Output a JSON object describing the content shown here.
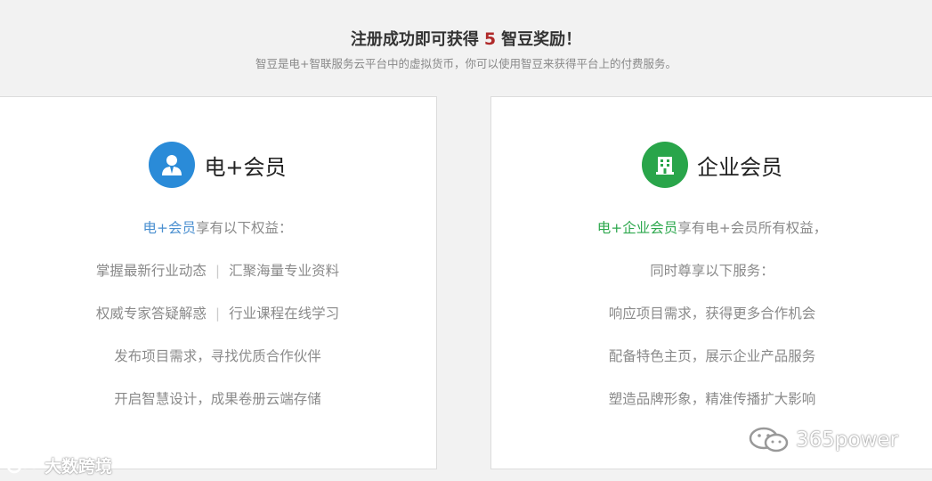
{
  "header": {
    "title_prefix": "注册成功即可获得",
    "title_number": "5",
    "title_suffix": "智豆奖励！",
    "subtitle": "智豆是电+智联服务云平台中的虚拟货币，你可以使用智豆来获得平台上的付费服务。"
  },
  "cards": [
    {
      "title": "电+会员",
      "icon": "user-icon",
      "color": "#2a8bd8",
      "intro_highlight": "电+会员",
      "intro_rest": "享有以下权益：",
      "pairs": [
        [
          "掌握最新行业动态",
          "汇聚海量专业资料"
        ],
        [
          "权威专家答疑解惑",
          "行业课程在线学习"
        ]
      ],
      "items": [
        "发布项目需求，寻找优质合作伙伴",
        "开启智慧设计，成果卷册云端存储"
      ]
    },
    {
      "title": "企业会员",
      "icon": "building-icon",
      "color": "#29a54a",
      "intro_highlight": "电+企业会员",
      "intro_rest": "享有电+会员所有权益，",
      "items": [
        "同时尊享以下服务：",
        "响应项目需求，获得更多合作机会",
        "配备特色主页，展示企业产品服务",
        "塑造品牌形象，精准传播扩大影响"
      ]
    }
  ],
  "watermarks": {
    "left": "大数跨境",
    "right": "365power"
  }
}
